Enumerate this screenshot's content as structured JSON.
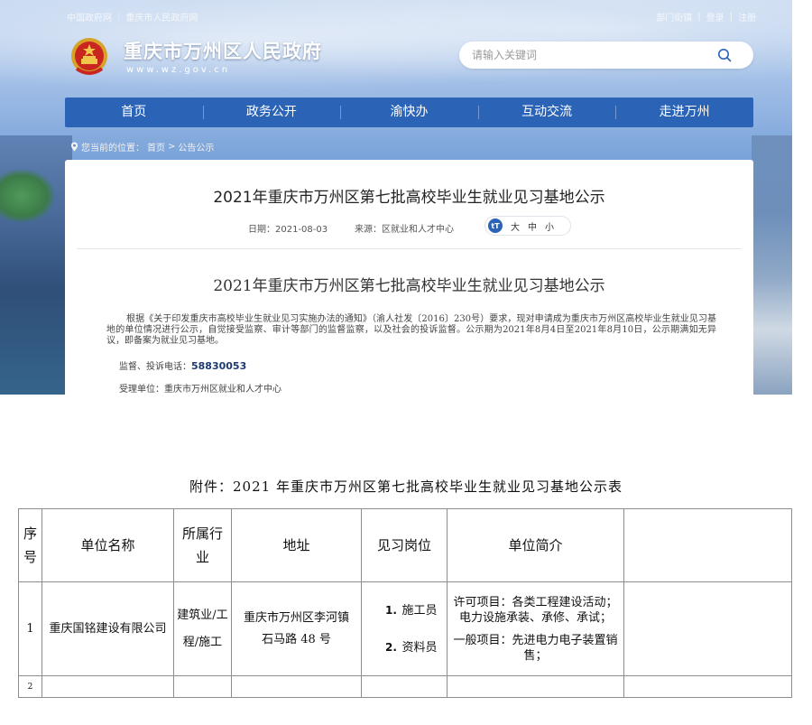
{
  "topbar": {
    "left_links": [
      "中国政府网",
      "重庆市人民政府网"
    ],
    "right_links": [
      "部门街镇",
      "登录",
      "注册"
    ],
    "separator": "|"
  },
  "site": {
    "title": "重庆市万州区人民政府",
    "url": "www.wz.gov.cn"
  },
  "search": {
    "placeholder": "请输入关键词"
  },
  "nav": {
    "items": [
      "首页",
      "政务公开",
      "渝快办",
      "互动交流",
      "走进万州"
    ]
  },
  "breadcrumb": {
    "prefix": "您当前的位置：",
    "home": "首页",
    "sep": ">",
    "current": "公告公示"
  },
  "article": {
    "title": "2021年重庆市万州区第七批高校毕业生就业见习基地公示",
    "date": "日期：2021-08-03",
    "source": "来源：区就业和人才中心",
    "fontsize": {
      "icon_text": "tT",
      "large": "大",
      "medium": "中",
      "small": "小"
    },
    "doc_title": "2021年重庆市万州区第七批高校毕业生就业见习基地公示",
    "body": "根据《关于印发重庆市高校毕业生就业见习实施办法的通知》（渝人社发〔2016〕230号）要求，现对申请成为重庆市万州区高校毕业生就业见习基地的单位情况进行公示，自觉接受监察、审计等部门的监督监察，以及社会的投诉监督。公示期为2021年8月4日至2021年8月10日，公示期满如无异议，即备案为就业见习基地。",
    "phone_label": "监督、投诉电话：",
    "phone": "58830053",
    "unit": "受理单位：重庆市万州区就业和人才中心"
  },
  "attachment": {
    "title": "附件：2021 年重庆市万州区第七批高校毕业生就业见习基地公示表",
    "headers": {
      "seq_1": "序",
      "seq_2": "号",
      "name": "单位名称",
      "industry_1": "所属行",
      "industry_2": "业",
      "address": "地址",
      "positions": "见习岗位",
      "intro": "单位简介"
    },
    "rows": [
      {
        "seq": "1",
        "name": "重庆国铭建设有限公司",
        "industry_1": "建筑业/工",
        "industry_2": "程/施工",
        "address_1": "重庆市万州区李河镇",
        "address_2": "石马路 48 号",
        "positions": [
          {
            "num": "1.",
            "label": "施工员"
          },
          {
            "num": "2.",
            "label": "资料员"
          }
        ],
        "intro_1": "许可项目：各类工程建设活动；电力设施承装、承修、承试；",
        "intro_2": "一般项目：先进电力电子装置销售；"
      },
      {
        "seq": "2"
      }
    ]
  },
  "colors": {
    "nav_bg": "#2b63b7",
    "accent": "#2b63b7"
  }
}
